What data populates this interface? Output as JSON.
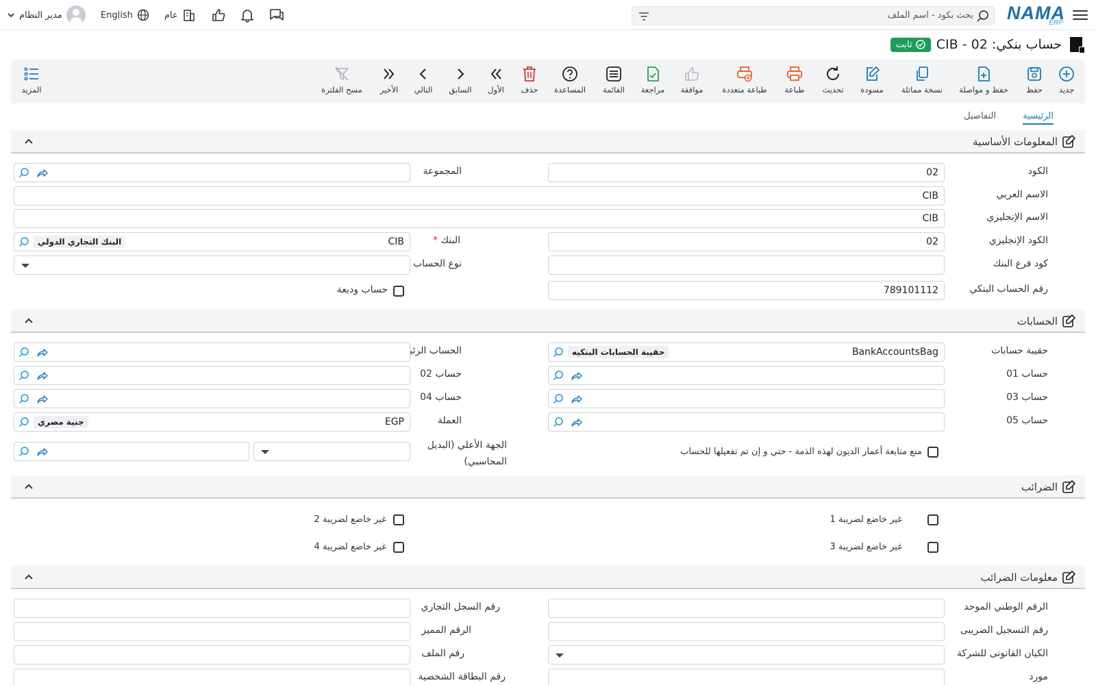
{
  "topbar": {
    "search_placeholder": "بحث بكود - اسم الملف",
    "logo_main": "NAMA",
    "logo_sub": "ERP",
    "user_name": "مدير النظام",
    "language": "English",
    "branch": "عام"
  },
  "header": {
    "title": "حساب بنكي: CIB - 02",
    "status": "ثابت"
  },
  "toolbar": {
    "new": "جديد",
    "save": "حفظ",
    "save_continue": "حفظ و مواصلة",
    "duplicate": "نسخة مماثلة",
    "draft": "مسودة",
    "refresh": "تحديث",
    "print": "طباعة",
    "multi_print": "طباعة متعددة",
    "approve": "موافقة",
    "review": "مراجعة",
    "list": "القائمة",
    "help": "المساعدة",
    "delete": "حذف",
    "first": "الأول",
    "previous": "السابق",
    "next": "التالي",
    "last": "الأخير",
    "clear_filter": "مسح الفلترة",
    "more": "المزيد"
  },
  "tabs": {
    "main": "الرئيسية",
    "details": "التفاصيل"
  },
  "basic": {
    "section": "المعلومات الأساسية",
    "code_label": "الكود",
    "code_value": "02",
    "group_label": "المجموعة",
    "arabic_name_label": "الاسم العربي",
    "arabic_name_value": "CIB",
    "english_name_label": "الاسم الإنجليزي",
    "english_name_value": "CIB",
    "english_code_label": "الكود الإنجليزي",
    "english_code_value": "02",
    "bank_label": "البنك",
    "bank_required": "*",
    "bank_code": "CIB",
    "bank_name": "البنك التجاري الدولي",
    "branch_code_label": "كود فرع البنك",
    "account_type_label": "نوع الحساب",
    "account_number_label": "رقم الحساب البنكي",
    "account_number_value": "789101112",
    "deposit_label": "حساب وديعة"
  },
  "accounts": {
    "section": "الحسابات",
    "bag_label": "حقيبة حسابات",
    "bag_code": "BankAccountsBag",
    "bag_name": "حقيبة الحسابات البنكيه",
    "main_label": "الحساب الرئيسي",
    "acc01_label": "حساب 01",
    "acc02_label": "حساب 02",
    "acc03_label": "حساب 03",
    "acc04_label": "حساب 04",
    "acc05_label": "حساب 05",
    "currency_label": "العملة",
    "currency_code": "EGP",
    "currency_name": "جنية مصري",
    "higher_label_1": "الجهة الأعلي (البديل",
    "higher_label_2": "المحاسبي)",
    "debt_aging_label": "منع متابعة أعمار الديون لهذه الذمة - حتي و إن تم تفعيلها للحساب"
  },
  "taxes": {
    "section": "الضرائب",
    "tax1": "غير خاضع لضريبة 1",
    "tax2": "غير خاضع لضريبة 2",
    "tax3": "غير خاضع لضريبة 3",
    "tax4": "غير خاضع لضريبة 4"
  },
  "tax_info": {
    "section": "معلومات الضرائب",
    "national_id_label": "الرقم الوطني الموحد",
    "commercial_reg_label": "رقم السجل التجاري",
    "tax_reg_label": "رقم التسجيل الضريبى",
    "distinct_no_label": "الرقم المميز",
    "legal_entity_label": "الكيان القانونى للشركة",
    "file_no_label": "رقم الملف",
    "supplier_label": "مورد",
    "id_card_label": "رقم البطاقة الشخصية"
  },
  "colors": {
    "accent": "#1a7bbf",
    "status_green": "#1e9c5a",
    "orange": "#e8622a",
    "green_icon": "#2e9e4f"
  }
}
